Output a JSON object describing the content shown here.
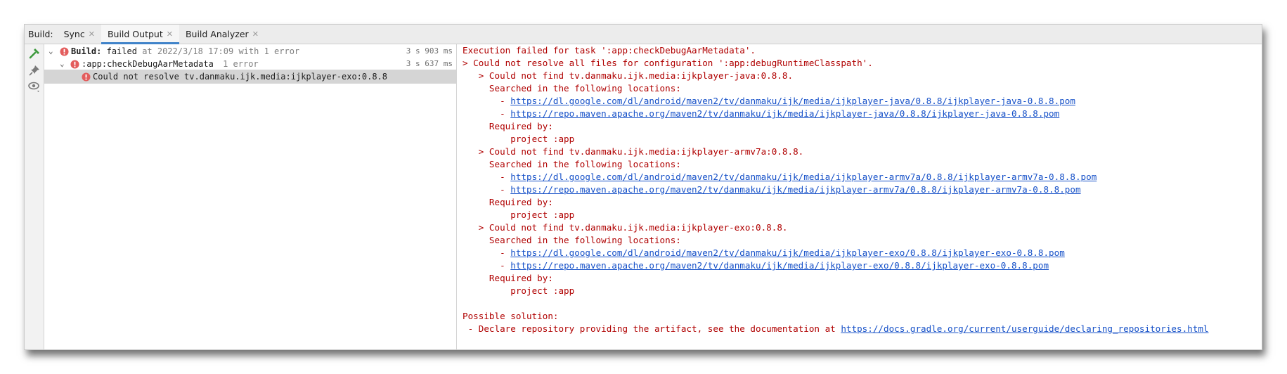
{
  "tabbar": {
    "lead": "Build:",
    "tabs": [
      {
        "label": "Sync",
        "active": false
      },
      {
        "label": "Build Output",
        "active": true
      },
      {
        "label": "Build Analyzer",
        "active": false
      }
    ]
  },
  "tree": {
    "root": {
      "label_bold": "Build:",
      "label_status": "failed",
      "label_rest": "at 2022/3/18 17:09 with 1 error",
      "time": "3 s 903 ms"
    },
    "task": {
      "label": ":app:checkDebugAarMetadata",
      "count": "1 error",
      "time": "3 s 637 ms"
    },
    "error": {
      "label": "Could not resolve tv.danmaku.ijk.media:ijkplayer-exo:0.8.8"
    }
  },
  "console": {
    "lines": [
      {
        "text": "Execution failed for task ':app:checkDebugAarMetadata'."
      },
      {
        "text": "> Could not resolve all files for configuration ':app:debugRuntimeClasspath'."
      },
      {
        "text": "   > Could not find tv.danmaku.ijk.media:ijkplayer-java:0.8.8."
      },
      {
        "text": "     Searched in the following locations:"
      },
      {
        "prefix": "       - ",
        "link": "https://dl.google.com/dl/android/maven2/tv/danmaku/ijk/media/ijkplayer-java/0.8.8/ijkplayer-java-0.8.8.pom"
      },
      {
        "prefix": "       - ",
        "link": "https://repo.maven.apache.org/maven2/tv/danmaku/ijk/media/ijkplayer-java/0.8.8/ijkplayer-java-0.8.8.pom"
      },
      {
        "text": "     Required by:"
      },
      {
        "text": "         project :app"
      },
      {
        "text": "   > Could not find tv.danmaku.ijk.media:ijkplayer-armv7a:0.8.8."
      },
      {
        "text": "     Searched in the following locations:"
      },
      {
        "prefix": "       - ",
        "link": "https://dl.google.com/dl/android/maven2/tv/danmaku/ijk/media/ijkplayer-armv7a/0.8.8/ijkplayer-armv7a-0.8.8.pom"
      },
      {
        "prefix": "       - ",
        "link": "https://repo.maven.apache.org/maven2/tv/danmaku/ijk/media/ijkplayer-armv7a/0.8.8/ijkplayer-armv7a-0.8.8.pom"
      },
      {
        "text": "     Required by:"
      },
      {
        "text": "         project :app"
      },
      {
        "text": "   > Could not find tv.danmaku.ijk.media:ijkplayer-exo:0.8.8."
      },
      {
        "text": "     Searched in the following locations:"
      },
      {
        "prefix": "       - ",
        "link": "https://dl.google.com/dl/android/maven2/tv/danmaku/ijk/media/ijkplayer-exo/0.8.8/ijkplayer-exo-0.8.8.pom"
      },
      {
        "prefix": "       - ",
        "link": "https://repo.maven.apache.org/maven2/tv/danmaku/ijk/media/ijkplayer-exo/0.8.8/ijkplayer-exo-0.8.8.pom"
      },
      {
        "text": "     Required by:"
      },
      {
        "text": "         project :app"
      },
      {
        "text": ""
      },
      {
        "text": "Possible solution:"
      },
      {
        "prefix": " - Declare repository providing the artifact, see the documentation at ",
        "link": "https://docs.gradle.org/current/userguide/declaring_repositories.html"
      }
    ]
  },
  "colors": {
    "error_text": "#b00000",
    "link": "#1550c8",
    "accent": "#4083c9",
    "error_icon": "#e35d5d"
  }
}
